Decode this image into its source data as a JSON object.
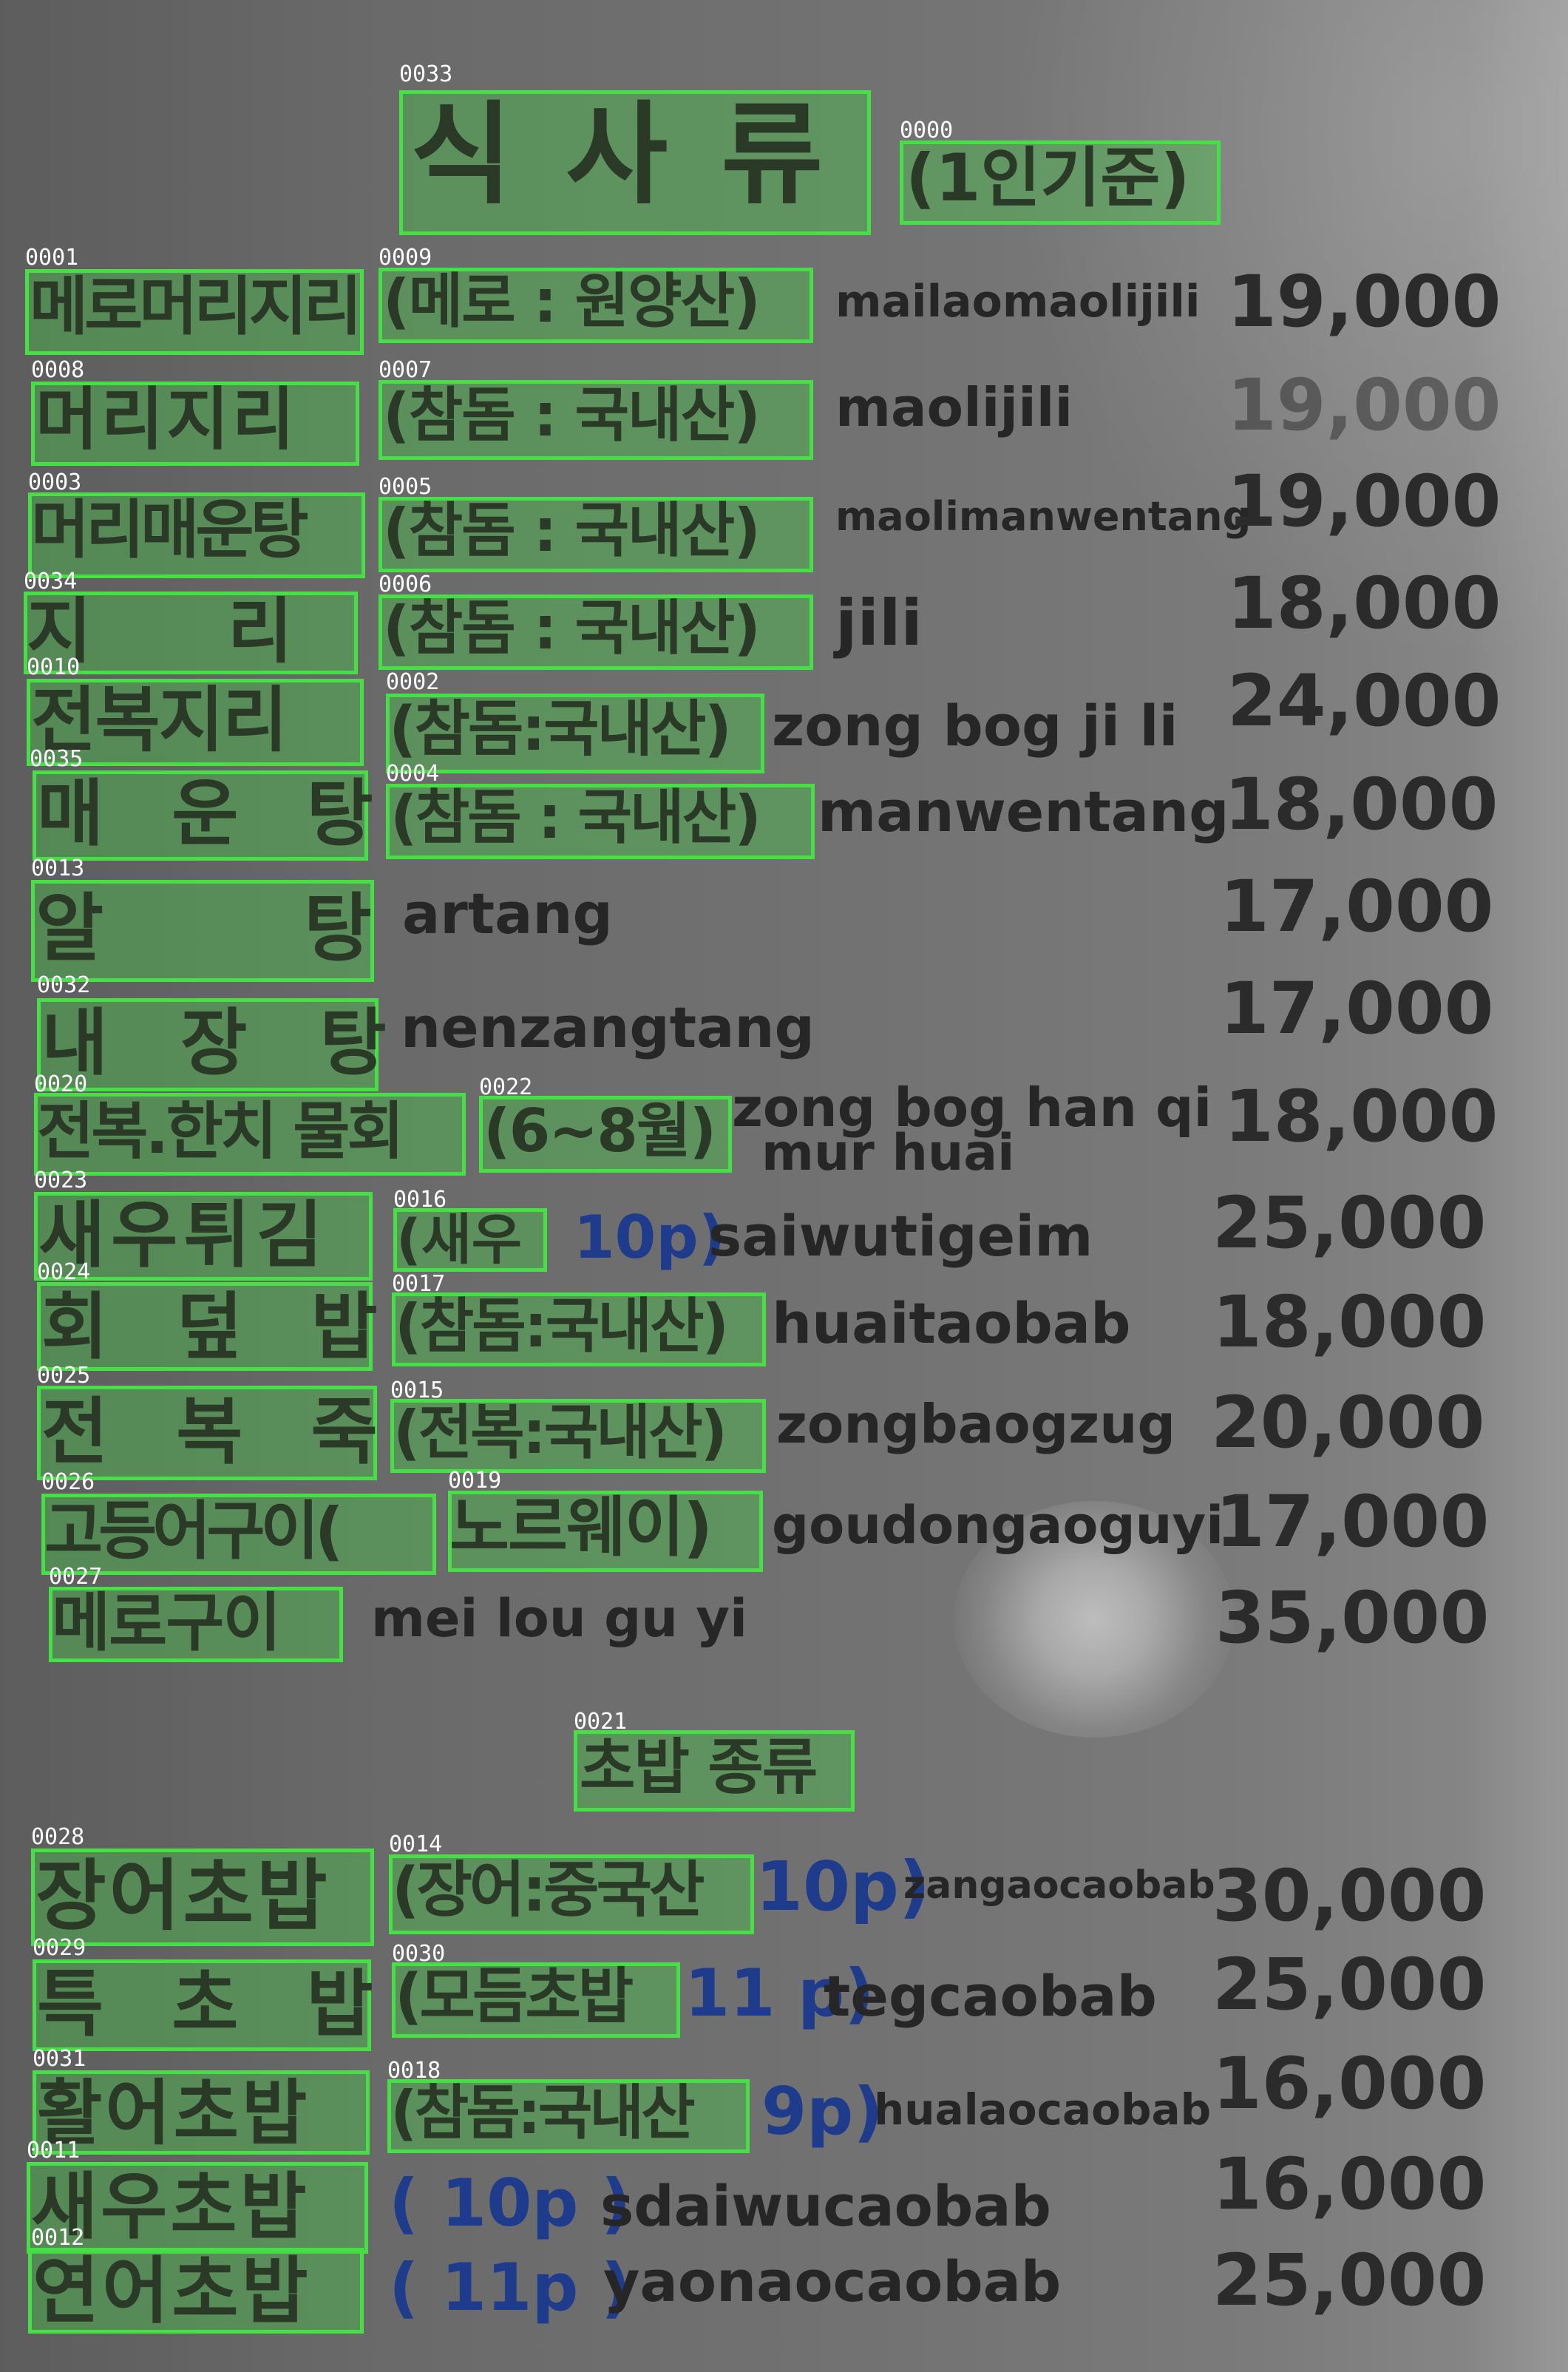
{
  "title": {
    "id": "0033",
    "text": "식 사 류"
  },
  "title_note": {
    "id": "0000",
    "text": "(1인기준)"
  },
  "section2": {
    "id": "0021",
    "text": "초밥 종류"
  },
  "rows": [
    {
      "name_id": "0001",
      "name": "메로머리지리",
      "note_id": "0009",
      "note": "(메로 : 원양산)",
      "romanized": "mailaomaolijili",
      "price": "19,000"
    },
    {
      "name_id": "0008",
      "name": "머리지리",
      "note_id": "0007",
      "note": "(참돔 : 국내산)",
      "romanized": "maolijili",
      "price": "19,000"
    },
    {
      "name_id": "0003",
      "name": "머리매운탕",
      "note_id": "0005",
      "note": "(참돔 : 국내산)",
      "romanized": "maolimanwentang",
      "price": "19,000"
    },
    {
      "name_id": "0034",
      "name": "지 리",
      "note_id": "0006",
      "note": "(참돔 : 국내산)",
      "romanized": "jili",
      "price": "18,000"
    },
    {
      "name_id": "0010",
      "name": "전복지리",
      "note_id": "0002",
      "note": "(참돔:국내산)",
      "romanized": "zong bog ji li",
      "price": "24,000"
    },
    {
      "name_id": "0035",
      "name": "매 운 탕",
      "note_id": "0004",
      "note": "(참돔 : 국내산)",
      "romanized": "manwentang",
      "price": "18,000"
    },
    {
      "name_id": "0013",
      "name": "알 탕",
      "romanized": "artang",
      "price": "17,000"
    },
    {
      "name_id": "0032",
      "name": "내 장 탕",
      "romanized": "nenzangtang",
      "price": "17,000"
    },
    {
      "name_id": "0020",
      "name": "전복.한치 물회",
      "note_id": "0022",
      "note": "(6~8월)",
      "romanized": "zong bog han qi",
      "romanized2": "mur huai",
      "price": "18,000"
    },
    {
      "name_id": "0023",
      "name": "새우튀김",
      "note_id": "0016",
      "note": "(새우",
      "extra": "10p)",
      "romanized": "saiwutigeim",
      "price": "25,000"
    },
    {
      "name_id": "0024",
      "name": "회 덮 밥",
      "note_id": "0017",
      "note": "(참돔:국내산)",
      "romanized": "huaitaobab",
      "price": "18,000"
    },
    {
      "name_id": "0025",
      "name": "전 복 죽",
      "note_id": "0015",
      "note": "(전복:국내산)",
      "romanized": "zongbaogzug",
      "price": "20,000"
    },
    {
      "name_id": "0026",
      "name": "고등어구이(",
      "note_id": "0019",
      "note": "노르웨이)",
      "romanized": "goudongaoguyi",
      "price": "17,000"
    },
    {
      "name_id": "0027",
      "name": "메로구이",
      "romanized": "mei lou gu yi",
      "price": "35,000"
    }
  ],
  "sushi": [
    {
      "name_id": "0028",
      "name": "장어초밥",
      "note_id": "0014",
      "note": "(장어:중국산",
      "extra": "10p)",
      "romanized": "zangaocaobab",
      "price": "30,000"
    },
    {
      "name_id": "0029",
      "name": "특 초 밥",
      "note_id": "0030",
      "note": "(모듬초밥",
      "extra": "11 p)",
      "romanized": "tegcaobab",
      "price": "25,000"
    },
    {
      "name_id": "0031",
      "name": "활어초밥",
      "note_id": "0018",
      "note": "(참돔:국내산",
      "extra": "9p)",
      "romanized": "hualaocaobab",
      "price": "16,000"
    },
    {
      "name_id": "0011",
      "name": "새우초밥",
      "extra": "( 10p )",
      "romanized": "sdaiwucaobab",
      "price": "16,000"
    },
    {
      "name_id": "0012",
      "name": "연어초밥",
      "extra": "( 11p )",
      "romanized": "yaonaocaobab",
      "price": "25,000"
    }
  ]
}
